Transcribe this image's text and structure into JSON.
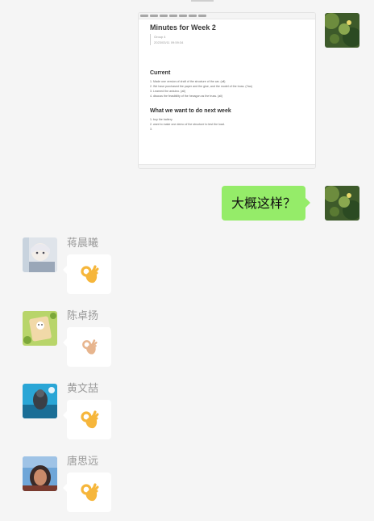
{
  "doc_card": {
    "title": "Minutes for Week 2",
    "meta_group": "Group 4",
    "meta_date": "2023/03/11 09:59:34",
    "heading_current": "Current",
    "current_items": [
      "1. Made one version of draft of the structure of the car. (all)",
      "2. We have purchased the paper and the glue, and the model of the truss. (Yao)",
      "3. Learned the arduino. (all)",
      "4. discuss the feasibility of the hexagon as the truss.  (all)"
    ],
    "heading_next": "What we want to do next week",
    "next_items": [
      "1. buy the battery",
      "2. want to make one demo of the structure to test the load.",
      "3."
    ]
  },
  "outgoing_message": "大概这样？",
  "incoming": [
    {
      "sender": "蒋晨曦",
      "emoji": "ok-hand-icon"
    },
    {
      "sender": "陈卓扬",
      "emoji": "ok-hand-icon"
    },
    {
      "sender": "黄文喆",
      "emoji": "ok-hand-icon"
    },
    {
      "sender": "唐思远",
      "emoji": "ok-hand-icon"
    }
  ],
  "colors": {
    "outgoing_bubble": "#95ec69",
    "background": "#f5f5f5",
    "sender_name": "#9a9a9a"
  }
}
